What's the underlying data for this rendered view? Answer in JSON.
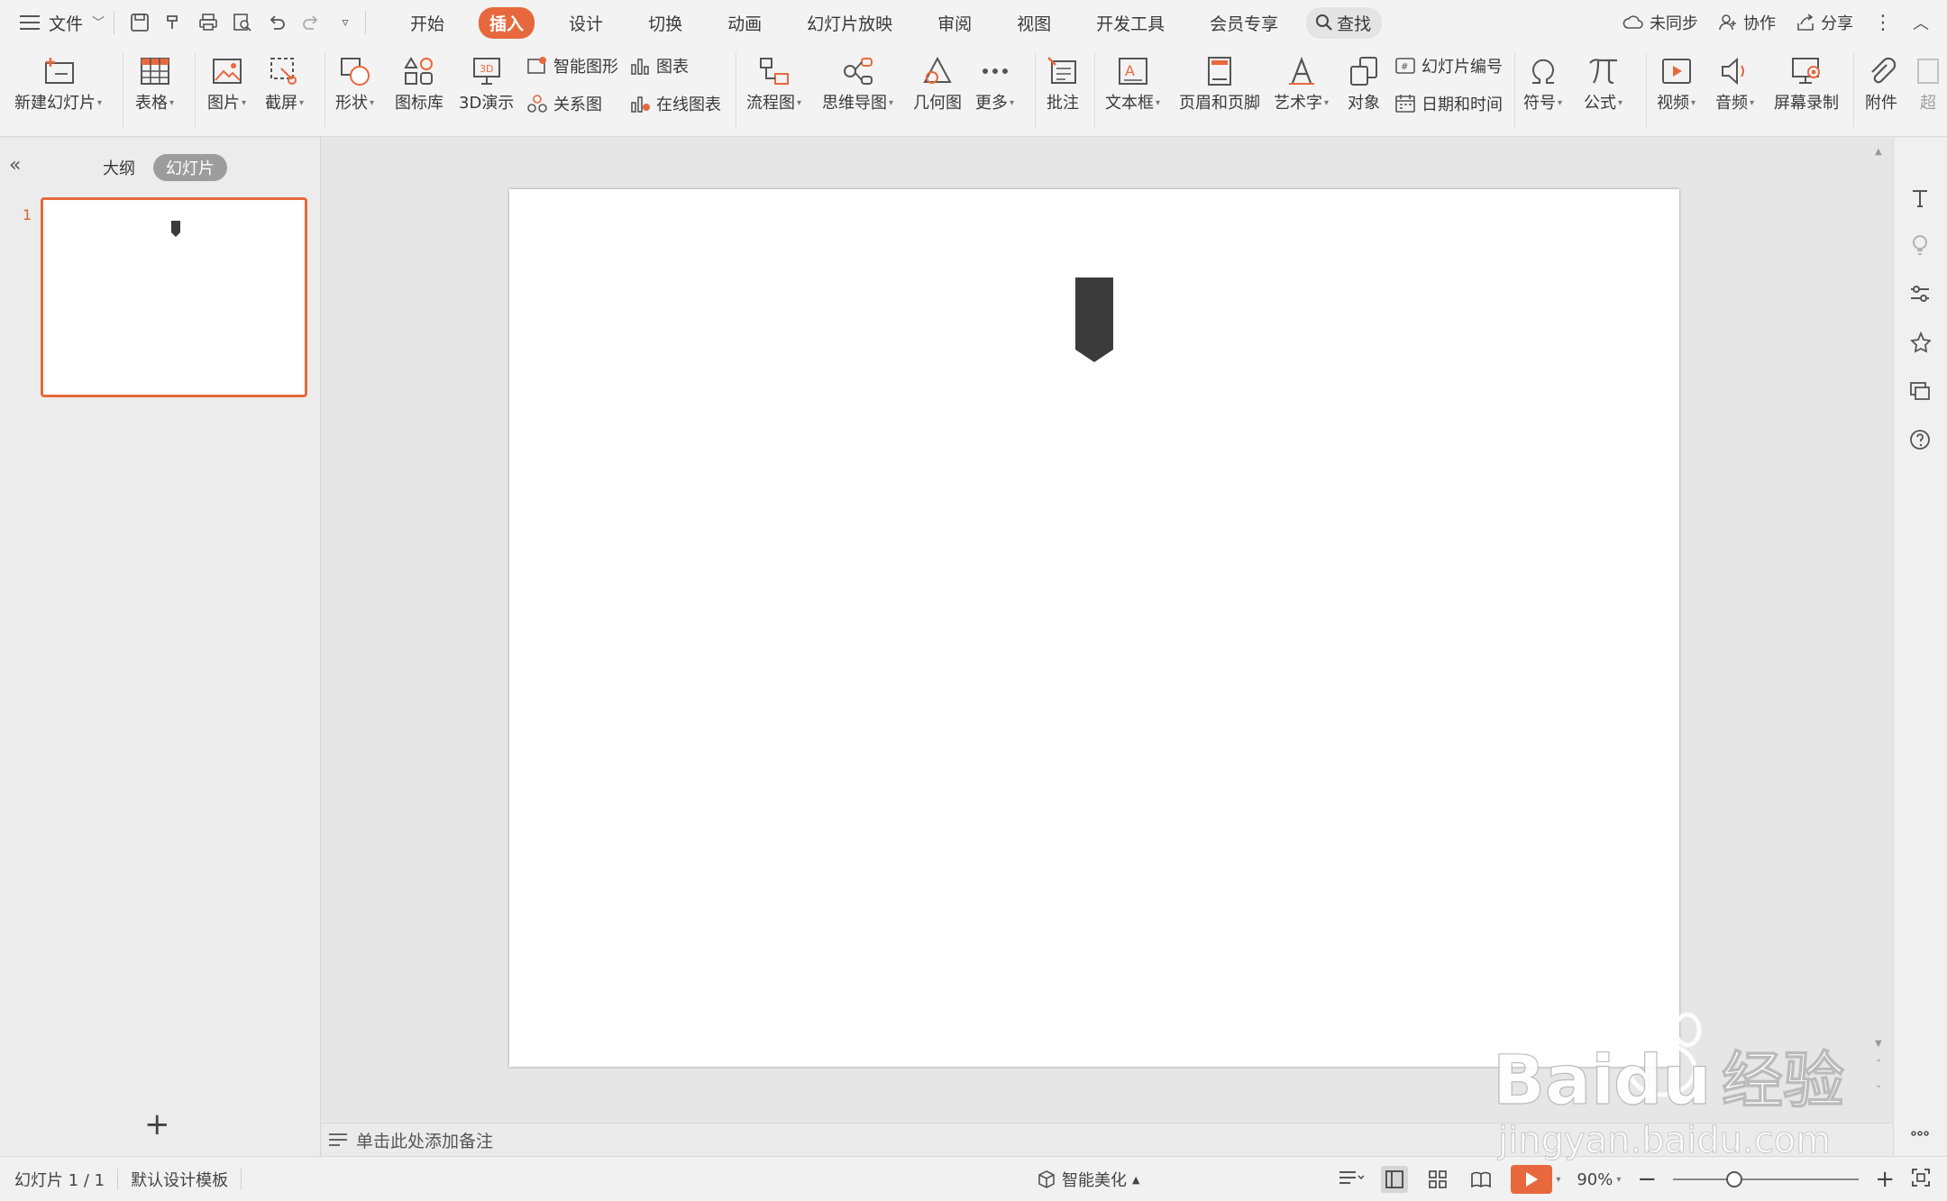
{
  "menu": {
    "file_label": "文件",
    "tabs": [
      {
        "label": "开始",
        "active": false
      },
      {
        "label": "插入",
        "active": true
      },
      {
        "label": "设计",
        "active": false
      },
      {
        "label": "切换",
        "active": false
      },
      {
        "label": "动画",
        "active": false
      },
      {
        "label": "幻灯片放映",
        "active": false
      },
      {
        "label": "审阅",
        "active": false
      },
      {
        "label": "视图",
        "active": false
      },
      {
        "label": "开发工具",
        "active": false
      },
      {
        "label": "会员专享",
        "active": false
      }
    ],
    "search_label": "查找",
    "sync_label": "未同步",
    "collab_label": "协作",
    "share_label": "分享"
  },
  "ribbon": {
    "new_slide": "新建幻灯片",
    "table": "表格",
    "picture": "图片",
    "screenshot": "截屏",
    "shape": "形状",
    "icon_lib": "图标库",
    "demo3d": "3D演示",
    "smart_graphic": "智能图形",
    "chart": "图表",
    "relation": "关系图",
    "online_chart": "在线图表",
    "flowchart": "流程图",
    "mindmap": "思维导图",
    "geometry": "几何图",
    "more": "更多",
    "comment": "批注",
    "textbox": "文本框",
    "header_footer": "页眉和页脚",
    "wordart": "艺术字",
    "object": "对象",
    "slide_number": "幻灯片编号",
    "date_time": "日期和时间",
    "symbol": "符号",
    "formula": "公式",
    "video": "视频",
    "audio": "音频",
    "screen_record": "屏幕录制",
    "attachment": "附件",
    "overflow": "超"
  },
  "left_panel": {
    "outline_tab": "大纲",
    "slides_tab": "幻灯片",
    "slide_number": "1"
  },
  "notes": {
    "placeholder": "单击此处添加备注"
  },
  "status": {
    "slide_counter": "幻灯片 1 / 1",
    "template": "默认设计模板",
    "beautify": "智能美化",
    "zoom": "90%",
    "zoom_fraction": 0.33
  },
  "slide": {
    "shape_color": "#3b3b3b"
  },
  "colors": {
    "accent": "#e8683d"
  }
}
